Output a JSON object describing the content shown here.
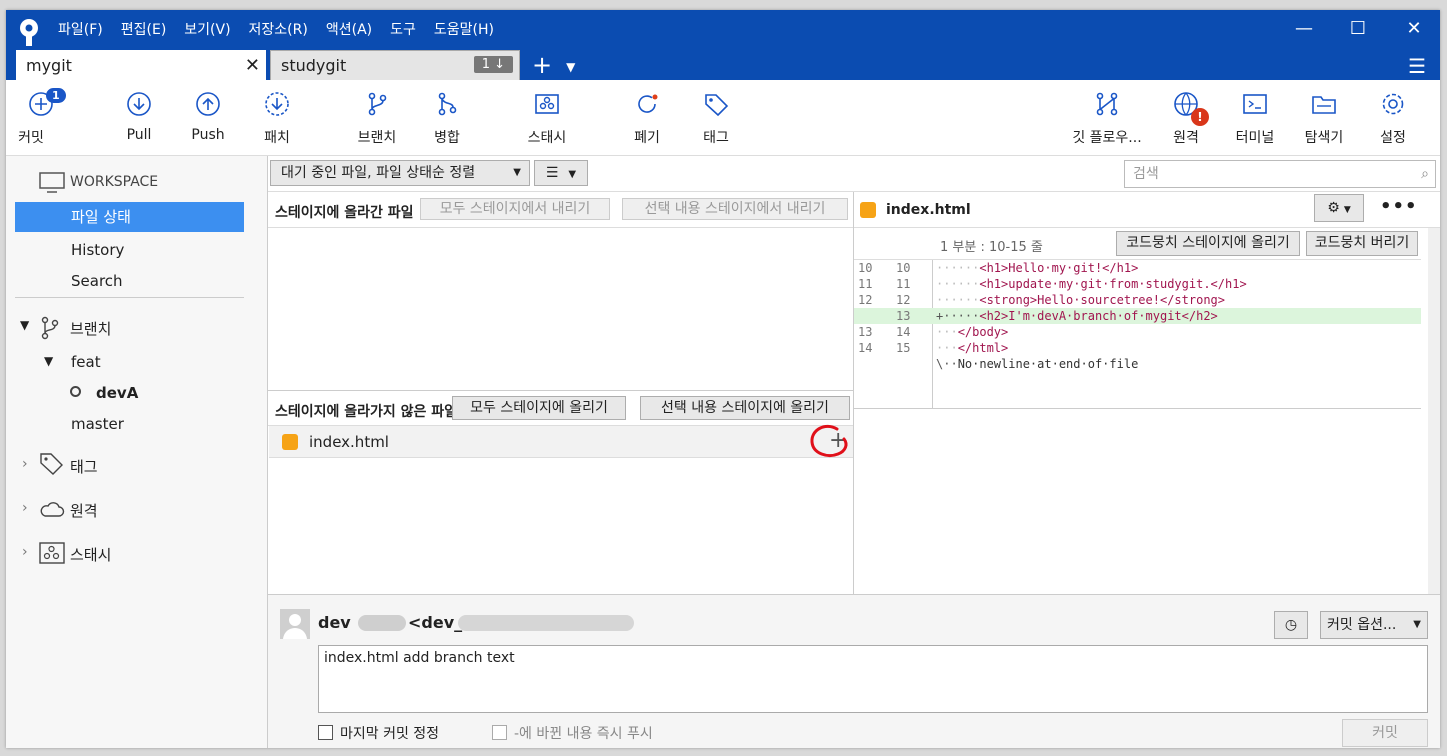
{
  "menu": [
    "파일(F)",
    "편집(E)",
    "보기(V)",
    "저장소(R)",
    "액션(A)",
    "도구",
    "도움말(H)"
  ],
  "tabs": [
    {
      "label": "mygit",
      "active": true
    },
    {
      "label": "studygit",
      "active": false,
      "badge": "1 ↓"
    }
  ],
  "toolbar": {
    "commit": {
      "label": "커밋",
      "badge": "1"
    },
    "pull": "Pull",
    "push": "Push",
    "patch": "패치",
    "branch": "브랜치",
    "merge": "병합",
    "stash": "스태시",
    "discard": "폐기",
    "tag": "태그",
    "gitflow": "깃 플로우...",
    "remote": "원격",
    "terminal": "터미널",
    "explorer": "탐색기",
    "settings": "설정"
  },
  "sidebar": {
    "workspace": "WORKSPACE",
    "items": [
      "파일 상태",
      "History",
      "Search"
    ],
    "branches": "브랜치",
    "feat": "feat",
    "current_branch": "devA",
    "master": "master",
    "tags": "태그",
    "remotes": "원격",
    "stashes": "스태시"
  },
  "filter": {
    "sort": "대기 중인 파일, 파일 상태순 정렬",
    "search_placeholder": "검색"
  },
  "staged": {
    "title": "스테이지에 올라간 파일",
    "unstage_all": "모두 스테이지에서 내리기",
    "unstage_selected": "선택 내용 스테이지에서 내리기"
  },
  "unstaged": {
    "title": "스테이지에 올라가지 않은 파일",
    "stage_all": "모두 스테이지에 올리기",
    "stage_selected": "선택 내용 스테이지에 올리기",
    "files": [
      "index.html"
    ]
  },
  "diff": {
    "filename": "index.html",
    "hunk": "1 부분 : 10-15 줄",
    "stage_hunk": "코드뭉치 스테이지에 올리기",
    "discard_hunk": "코드뭉치 버리기",
    "lines": [
      {
        "a": "10",
        "b": "10",
        "pre": "······",
        "text": "<h1>Hello·my·git!</h1>",
        "add": false
      },
      {
        "a": "11",
        "b": "11",
        "pre": "······",
        "text": "<h1>update·my·git·from·studygit.</h1>",
        "add": false
      },
      {
        "a": "12",
        "b": "12",
        "pre": "······",
        "text": "<strong>Hello·sourcetree!</strong>",
        "add": false
      },
      {
        "a": "",
        "b": "13",
        "pre": "+·····",
        "text": "<h2>I'm·devA·branch·of·mygit</h2>",
        "add": true
      },
      {
        "a": "13",
        "b": "14",
        "pre": "···",
        "text": "</body>",
        "add": false
      },
      {
        "a": "14",
        "b": "15",
        "pre": "···",
        "text": "</html>",
        "add": false
      },
      {
        "a": "",
        "b": "",
        "pre": "\\··",
        "text": "No·newline·at·end·of·file",
        "add": false
      }
    ]
  },
  "commit": {
    "author": "dev",
    "email_prefix": "<dev_",
    "options": "커밋 옵션...",
    "message": "index.html add branch text",
    "amend": "마지막 커밋 정정",
    "push_now": "-에 바뀐 내용 즉시 푸시",
    "commit_btn": "커밋"
  },
  "colors": {
    "titlebar": "#0b4cb1",
    "selection": "#3c8ff0",
    "added_line": "#dcf5dc",
    "annotation": "#e0101a"
  }
}
